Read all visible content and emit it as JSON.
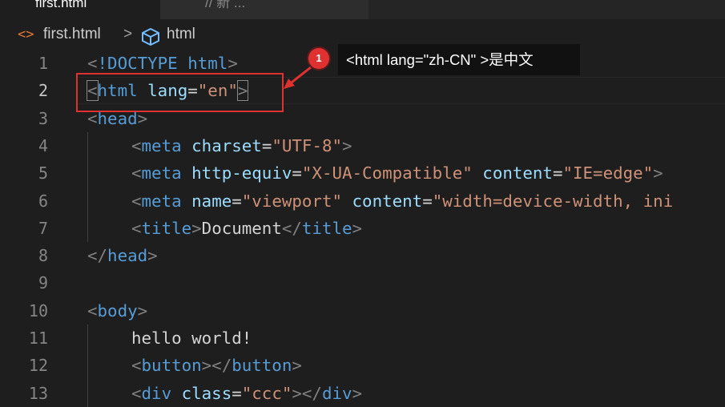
{
  "tabs": [
    {
      "label": "first.html",
      "active": true
    },
    {
      "label": "// 新 ...",
      "active": false
    }
  ],
  "breadcrumb": {
    "file_icon": "html-file-icon",
    "file": "first.html",
    "separator": ">",
    "element_icon": "cube-icon",
    "element": "html"
  },
  "editor": {
    "active_line": 2,
    "lines": [
      {
        "number": "1",
        "indent": 0,
        "tokens": [
          [
            "punct",
            "<"
          ],
          [
            "tag",
            "!DOCTYPE"
          ],
          [
            "text",
            " "
          ],
          [
            "tag",
            "html"
          ],
          [
            "punct",
            ">"
          ]
        ]
      },
      {
        "number": "2",
        "indent": 0,
        "tokens": [
          [
            "punct",
            "<"
          ],
          [
            "tag",
            "html"
          ],
          [
            "text",
            " "
          ],
          [
            "attr",
            "lang"
          ],
          [
            "text",
            "="
          ],
          [
            "str",
            "\"en\""
          ],
          [
            "punct",
            ">"
          ]
        ]
      },
      {
        "number": "3",
        "indent": 0,
        "tokens": [
          [
            "punct",
            "<"
          ],
          [
            "tag",
            "head"
          ],
          [
            "punct",
            ">"
          ]
        ]
      },
      {
        "number": "4",
        "indent": 1,
        "tokens": [
          [
            "punct",
            "<"
          ],
          [
            "tag",
            "meta"
          ],
          [
            "text",
            " "
          ],
          [
            "attr",
            "charset"
          ],
          [
            "text",
            "="
          ],
          [
            "str",
            "\"UTF-8\""
          ],
          [
            "punct",
            ">"
          ]
        ]
      },
      {
        "number": "5",
        "indent": 1,
        "tokens": [
          [
            "punct",
            "<"
          ],
          [
            "tag",
            "meta"
          ],
          [
            "text",
            " "
          ],
          [
            "attr",
            "http-equiv"
          ],
          [
            "text",
            "="
          ],
          [
            "str",
            "\"X-UA-Compatible\""
          ],
          [
            "text",
            " "
          ],
          [
            "attr",
            "content"
          ],
          [
            "text",
            "="
          ],
          [
            "str",
            "\"IE=edge\""
          ],
          [
            "punct",
            ">"
          ]
        ]
      },
      {
        "number": "6",
        "indent": 1,
        "tokens": [
          [
            "punct",
            "<"
          ],
          [
            "tag",
            "meta"
          ],
          [
            "text",
            " "
          ],
          [
            "attr",
            "name"
          ],
          [
            "text",
            "="
          ],
          [
            "str",
            "\"viewport\""
          ],
          [
            "text",
            " "
          ],
          [
            "attr",
            "content"
          ],
          [
            "text",
            "="
          ],
          [
            "str",
            "\"width=device-width, ini"
          ]
        ]
      },
      {
        "number": "7",
        "indent": 1,
        "tokens": [
          [
            "punct",
            "<"
          ],
          [
            "tag",
            "title"
          ],
          [
            "punct",
            ">"
          ],
          [
            "text",
            "Document"
          ],
          [
            "punct",
            "</"
          ],
          [
            "tag",
            "title"
          ],
          [
            "punct",
            ">"
          ]
        ]
      },
      {
        "number": "8",
        "indent": 0,
        "tokens": [
          [
            "punct",
            "</"
          ],
          [
            "tag",
            "head"
          ],
          [
            "punct",
            ">"
          ]
        ]
      },
      {
        "number": "9",
        "indent": 0,
        "tokens": []
      },
      {
        "number": "10",
        "indent": 0,
        "tokens": [
          [
            "punct",
            "<"
          ],
          [
            "tag",
            "body"
          ],
          [
            "punct",
            ">"
          ]
        ]
      },
      {
        "number": "11",
        "indent": 1,
        "tokens": [
          [
            "text",
            "hello world!"
          ]
        ]
      },
      {
        "number": "12",
        "indent": 1,
        "tokens": [
          [
            "punct",
            "<"
          ],
          [
            "tag",
            "button"
          ],
          [
            "punct",
            "></"
          ],
          [
            "tag",
            "button"
          ],
          [
            "punct",
            ">"
          ]
        ]
      },
      {
        "number": "13",
        "indent": 1,
        "tokens": [
          [
            "punct",
            "<"
          ],
          [
            "tag",
            "div"
          ],
          [
            "text",
            " "
          ],
          [
            "attr",
            "class"
          ],
          [
            "text",
            "="
          ],
          [
            "str",
            "\"ccc\""
          ],
          [
            "punct",
            "></"
          ],
          [
            "tag",
            "div"
          ],
          [
            "punct",
            ">"
          ]
        ]
      }
    ]
  },
  "annotation": {
    "badge": "1",
    "tooltip": "<html lang=\"zh-CN\" >是中文",
    "color": "#e03131"
  },
  "colors": {
    "background": "#1e1e1e",
    "tag": "#569cd6",
    "attribute": "#9cdcfe",
    "string": "#ce9178",
    "punctuation": "#808080",
    "text": "#d4d4d4"
  }
}
